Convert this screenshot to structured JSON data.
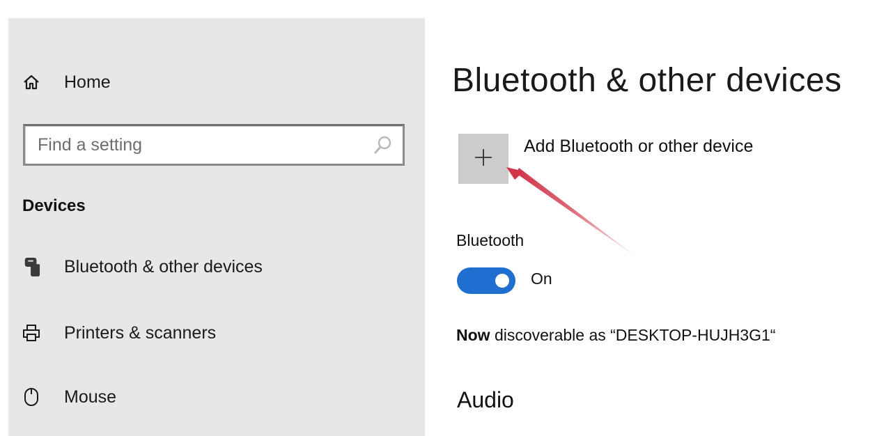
{
  "sidebar": {
    "home_label": "Home",
    "search_placeholder": "Find a setting",
    "section_title": "Devices",
    "items": [
      {
        "label": "Bluetooth & other devices",
        "icon": "bluetooth-device-icon"
      },
      {
        "label": "Printers & scanners",
        "icon": "printer-icon"
      },
      {
        "label": "Mouse",
        "icon": "mouse-icon"
      }
    ]
  },
  "main": {
    "title": "Bluetooth & other devices",
    "add_device_label": "Add Bluetooth or other device",
    "bluetooth_heading": "Bluetooth",
    "bluetooth_state": "On",
    "discoverable_prefix": "Now",
    "discoverable_text": " discoverable as “DESKTOP-HUJH3G1“",
    "audio_heading": "Audio"
  },
  "colors": {
    "sidebar_bg": "#e7e7e7",
    "toggle_on": "#1f6fd1",
    "add_tile_bg": "#cccccc",
    "annotation_arrow": "#d0354a"
  }
}
